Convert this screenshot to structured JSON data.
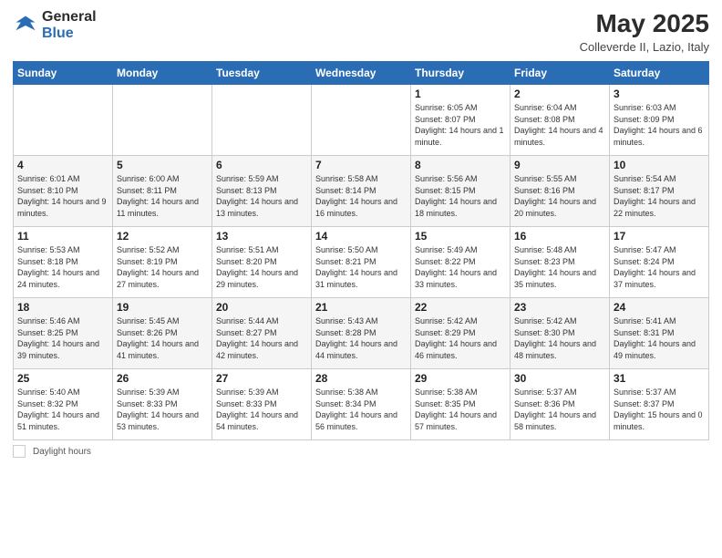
{
  "header": {
    "logo_general": "General",
    "logo_blue": "Blue",
    "month_year": "May 2025",
    "location": "Colleverde II, Lazio, Italy"
  },
  "days_of_week": [
    "Sunday",
    "Monday",
    "Tuesday",
    "Wednesday",
    "Thursday",
    "Friday",
    "Saturday"
  ],
  "weeks": [
    [
      {
        "day": "",
        "info": ""
      },
      {
        "day": "",
        "info": ""
      },
      {
        "day": "",
        "info": ""
      },
      {
        "day": "",
        "info": ""
      },
      {
        "day": "1",
        "info": "Sunrise: 6:05 AM\nSunset: 8:07 PM\nDaylight: 14 hours and 1 minute."
      },
      {
        "day": "2",
        "info": "Sunrise: 6:04 AM\nSunset: 8:08 PM\nDaylight: 14 hours and 4 minutes."
      },
      {
        "day": "3",
        "info": "Sunrise: 6:03 AM\nSunset: 8:09 PM\nDaylight: 14 hours and 6 minutes."
      }
    ],
    [
      {
        "day": "4",
        "info": "Sunrise: 6:01 AM\nSunset: 8:10 PM\nDaylight: 14 hours and 9 minutes."
      },
      {
        "day": "5",
        "info": "Sunrise: 6:00 AM\nSunset: 8:11 PM\nDaylight: 14 hours and 11 minutes."
      },
      {
        "day": "6",
        "info": "Sunrise: 5:59 AM\nSunset: 8:13 PM\nDaylight: 14 hours and 13 minutes."
      },
      {
        "day": "7",
        "info": "Sunrise: 5:58 AM\nSunset: 8:14 PM\nDaylight: 14 hours and 16 minutes."
      },
      {
        "day": "8",
        "info": "Sunrise: 5:56 AM\nSunset: 8:15 PM\nDaylight: 14 hours and 18 minutes."
      },
      {
        "day": "9",
        "info": "Sunrise: 5:55 AM\nSunset: 8:16 PM\nDaylight: 14 hours and 20 minutes."
      },
      {
        "day": "10",
        "info": "Sunrise: 5:54 AM\nSunset: 8:17 PM\nDaylight: 14 hours and 22 minutes."
      }
    ],
    [
      {
        "day": "11",
        "info": "Sunrise: 5:53 AM\nSunset: 8:18 PM\nDaylight: 14 hours and 24 minutes."
      },
      {
        "day": "12",
        "info": "Sunrise: 5:52 AM\nSunset: 8:19 PM\nDaylight: 14 hours and 27 minutes."
      },
      {
        "day": "13",
        "info": "Sunrise: 5:51 AM\nSunset: 8:20 PM\nDaylight: 14 hours and 29 minutes."
      },
      {
        "day": "14",
        "info": "Sunrise: 5:50 AM\nSunset: 8:21 PM\nDaylight: 14 hours and 31 minutes."
      },
      {
        "day": "15",
        "info": "Sunrise: 5:49 AM\nSunset: 8:22 PM\nDaylight: 14 hours and 33 minutes."
      },
      {
        "day": "16",
        "info": "Sunrise: 5:48 AM\nSunset: 8:23 PM\nDaylight: 14 hours and 35 minutes."
      },
      {
        "day": "17",
        "info": "Sunrise: 5:47 AM\nSunset: 8:24 PM\nDaylight: 14 hours and 37 minutes."
      }
    ],
    [
      {
        "day": "18",
        "info": "Sunrise: 5:46 AM\nSunset: 8:25 PM\nDaylight: 14 hours and 39 minutes."
      },
      {
        "day": "19",
        "info": "Sunrise: 5:45 AM\nSunset: 8:26 PM\nDaylight: 14 hours and 41 minutes."
      },
      {
        "day": "20",
        "info": "Sunrise: 5:44 AM\nSunset: 8:27 PM\nDaylight: 14 hours and 42 minutes."
      },
      {
        "day": "21",
        "info": "Sunrise: 5:43 AM\nSunset: 8:28 PM\nDaylight: 14 hours and 44 minutes."
      },
      {
        "day": "22",
        "info": "Sunrise: 5:42 AM\nSunset: 8:29 PM\nDaylight: 14 hours and 46 minutes."
      },
      {
        "day": "23",
        "info": "Sunrise: 5:42 AM\nSunset: 8:30 PM\nDaylight: 14 hours and 48 minutes."
      },
      {
        "day": "24",
        "info": "Sunrise: 5:41 AM\nSunset: 8:31 PM\nDaylight: 14 hours and 49 minutes."
      }
    ],
    [
      {
        "day": "25",
        "info": "Sunrise: 5:40 AM\nSunset: 8:32 PM\nDaylight: 14 hours and 51 minutes."
      },
      {
        "day": "26",
        "info": "Sunrise: 5:39 AM\nSunset: 8:33 PM\nDaylight: 14 hours and 53 minutes."
      },
      {
        "day": "27",
        "info": "Sunrise: 5:39 AM\nSunset: 8:33 PM\nDaylight: 14 hours and 54 minutes."
      },
      {
        "day": "28",
        "info": "Sunrise: 5:38 AM\nSunset: 8:34 PM\nDaylight: 14 hours and 56 minutes."
      },
      {
        "day": "29",
        "info": "Sunrise: 5:38 AM\nSunset: 8:35 PM\nDaylight: 14 hours and 57 minutes."
      },
      {
        "day": "30",
        "info": "Sunrise: 5:37 AM\nSunset: 8:36 PM\nDaylight: 14 hours and 58 minutes."
      },
      {
        "day": "31",
        "info": "Sunrise: 5:37 AM\nSunset: 8:37 PM\nDaylight: 15 hours and 0 minutes."
      }
    ]
  ],
  "legend": {
    "label": "Daylight hours"
  }
}
